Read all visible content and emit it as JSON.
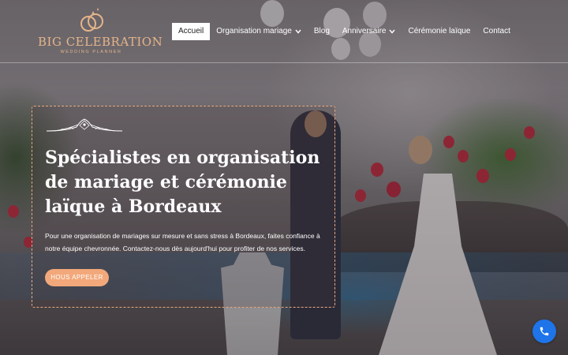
{
  "logo": {
    "name": "BIG CELEBRATION",
    "tagline": "WEDDING PLANNER",
    "icon": "rings-icon",
    "color": "#e4b48a"
  },
  "nav": {
    "items": [
      {
        "label": "Accueil",
        "active": true
      },
      {
        "label": "Organisation mariage",
        "dropdown": true
      },
      {
        "label": "Blog"
      },
      {
        "label": "Anniversaire",
        "dropdown": true
      },
      {
        "label": "Cérémonie laïque"
      },
      {
        "label": "Contact"
      }
    ]
  },
  "hero": {
    "ornament_icon": "lace-ornament-icon",
    "title": "Spécialistes en organisation de mariage et cérémonie laïque à Bordeaux",
    "text": "Pour une organisation de mariages sur mesure et sans stress à Bordeaux, faites confiance à notre équipe chevronnée. Contactez-nous dès aujourd'hui pour profiter de nos services.",
    "cta_label": "HOUS APPELER",
    "accent": "#f2a87a"
  },
  "floating": {
    "phone_icon": "phone-icon",
    "color": "#1e74e8"
  }
}
